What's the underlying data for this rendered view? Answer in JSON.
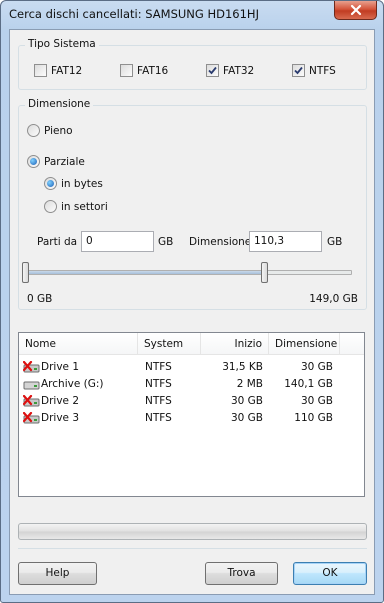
{
  "window": {
    "title": "Cerca dischi cancellati: SAMSUNG HD161HJ"
  },
  "tipo_sistema": {
    "label": "Tipo Sistema",
    "options": [
      {
        "label": "FAT12",
        "checked": false
      },
      {
        "label": "FAT16",
        "checked": false
      },
      {
        "label": "FAT32",
        "checked": true
      },
      {
        "label": "NTFS",
        "checked": true
      }
    ]
  },
  "dimensione": {
    "label": "Dimensione",
    "pieno_label": "Pieno",
    "parziale_label": "Parziale",
    "selected": "Parziale",
    "in_bytes_label": "in bytes",
    "in_settori_label": "in settori",
    "unit_selected": "in bytes",
    "parti_da_label": "Parti da",
    "parti_da_value": "0",
    "parti_da_unit": "GB",
    "dimensione_label": "Dimensione",
    "dimensione_value": "110,3",
    "dimensione_unit": "GB",
    "slider_min_label": "0 GB",
    "slider_max_label": "149,0 GB",
    "range_start_fraction": 0.0,
    "range_end_fraction": 0.74
  },
  "results": {
    "columns": [
      "Nome",
      "System",
      "Inizio",
      "Dimensione"
    ],
    "rows": [
      {
        "name": "Drive 1",
        "system": "NTFS",
        "start": "31,5 KB",
        "size": "30 GB",
        "deleted": true
      },
      {
        "name": "Archive (G:)",
        "system": "NTFS",
        "start": "2 MB",
        "size": "140,1 GB",
        "deleted": false
      },
      {
        "name": "Drive 2",
        "system": "NTFS",
        "start": "30 GB",
        "size": "30 GB",
        "deleted": true
      },
      {
        "name": "Drive 3",
        "system": "NTFS",
        "start": "30 GB",
        "size": "110 GB",
        "deleted": true
      }
    ]
  },
  "progress": {
    "value": 0
  },
  "buttons": {
    "help": "Help",
    "trova": "Trova",
    "ok": "OK"
  },
  "icons": {
    "close": "close-icon",
    "drive": "hard-drive-icon",
    "deleted_drive": "deleted-drive-icon",
    "check": "check-icon"
  },
  "colors": {
    "frame": "#bcd3ee",
    "close_button": "#c13c22",
    "client_bg": "#f0f0f0",
    "default_button_border": "#3c7fb1"
  }
}
